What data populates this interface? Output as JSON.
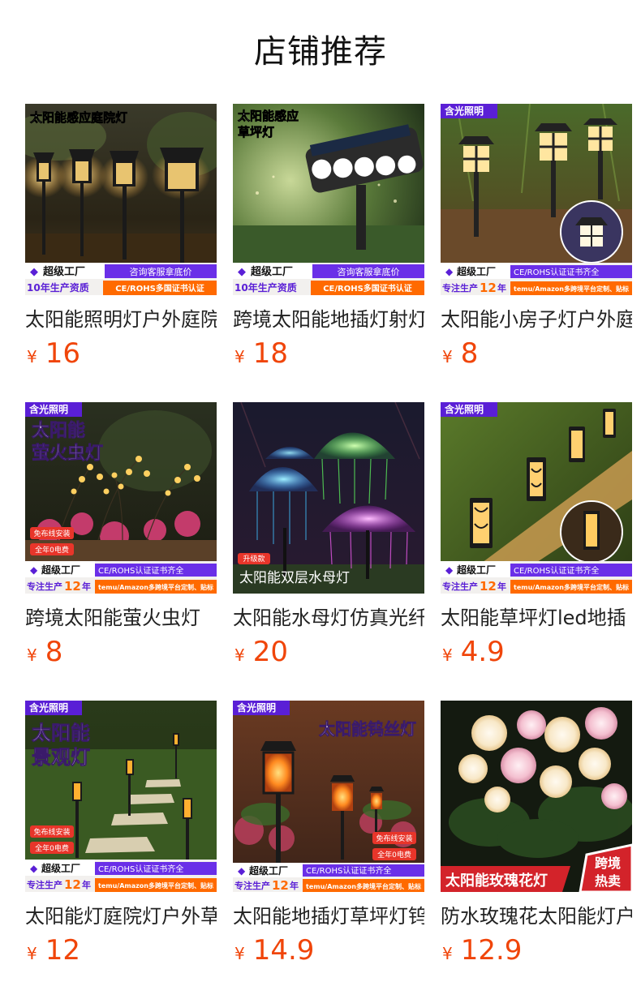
{
  "section_title": "店铺推荐",
  "currency_symbol": "¥",
  "colors": {
    "price": "#f0450a",
    "badge_purple": "#5a1fd6",
    "badge_orange": "#ff6a00",
    "brand_red": "#d3232a"
  },
  "products": [
    {
      "title": "太阳能照明灯户外庭院",
      "price": "16",
      "image": {
        "headline": "太阳能感应庭院灯",
        "badge": "超级工厂",
        "banner_left": "10年生产资质",
        "banner_right_top": "咨询客服拿底价",
        "banner_right_bottom": "CE/ROHS多国证书认证"
      }
    },
    {
      "title": "跨境太阳能地插灯射灯",
      "price": "18",
      "image": {
        "headline_line1": "太阳能感应",
        "headline_line2": "草坪灯",
        "badge": "超级工厂",
        "banner_left": "10年生产资质",
        "banner_right_top": "咨询客服拿底价",
        "banner_right_bottom": "CE/ROHS多国证书认证"
      }
    },
    {
      "title": "太阳能小房子灯户外庭院",
      "price": "8",
      "image": {
        "tag": "含光照明",
        "badge": "超级工厂",
        "banner_left_prefix": "专注生产",
        "banner_left_num": "12",
        "banner_left_suffix": "年",
        "banner_right_top": "CE/ROHS认证证书齐全",
        "banner_right_bottom": "temu/Amazon多跨境平台定制、贴标"
      }
    },
    {
      "title": "跨境太阳能萤火虫灯",
      "price": "8",
      "image": {
        "tag": "含光照明",
        "headline_line1": "太阳能",
        "headline_line2": "萤火虫灯",
        "chip1": "免布线安装",
        "chip2": "全年0电费",
        "badge": "超级工厂",
        "banner_left_prefix": "专注生产",
        "banner_left_num": "12",
        "banner_left_suffix": "年",
        "banner_right_top": "CE/ROHS认证证书齐全",
        "banner_right_bottom": "temu/Amazon多跨境平台定制、贴标"
      }
    },
    {
      "title": "太阳能水母灯仿真光纤",
      "price": "20",
      "image": {
        "chip": "升级款",
        "caption": "太阳能双层水母灯"
      }
    },
    {
      "title": "太阳能草坪灯led地插",
      "price": "4.9",
      "image": {
        "tag": "含光照明",
        "badge": "超级工厂",
        "banner_left_prefix": "专注生产",
        "banner_left_num": "12",
        "banner_left_suffix": "年",
        "banner_right_top": "CE/ROHS认证证书齐全",
        "banner_right_bottom": "temu/Amazon多跨境平台定制、贴标"
      }
    },
    {
      "title": "太阳能灯庭院灯户外草坪",
      "price": "12",
      "image": {
        "tag": "含光照明",
        "headline_line1": "太阳能",
        "headline_line2": "景观灯",
        "chip1": "免布线安装",
        "chip2": "全年0电费",
        "badge": "超级工厂",
        "banner_left_prefix": "专注生产",
        "banner_left_num": "12",
        "banner_left_suffix": "年",
        "banner_right_top": "CE/ROHS认证证书齐全",
        "banner_right_bottom": "temu/Amazon多跨境平台定制、贴标"
      }
    },
    {
      "title": "太阳能地插灯草坪灯钨丝",
      "price": "14.9",
      "image": {
        "tag": "含光照明",
        "headline": "太阳能钨丝灯",
        "chip1": "免布线安装",
        "chip2": "全年0电费",
        "badge": "超级工厂",
        "banner_left_prefix": "专注生产",
        "banner_left_num": "12",
        "banner_left_suffix": "年",
        "banner_right_top": "CE/ROHS认证证书齐全",
        "banner_right_bottom": "temu/Amazon多跨境平台定制、贴标"
      }
    },
    {
      "title": "防水玫瑰花太阳能灯户外",
      "price": "12.9",
      "image": {
        "caption": "太阳能玫瑰花灯",
        "corner_line1": "跨境",
        "corner_line2": "热卖"
      }
    }
  ]
}
